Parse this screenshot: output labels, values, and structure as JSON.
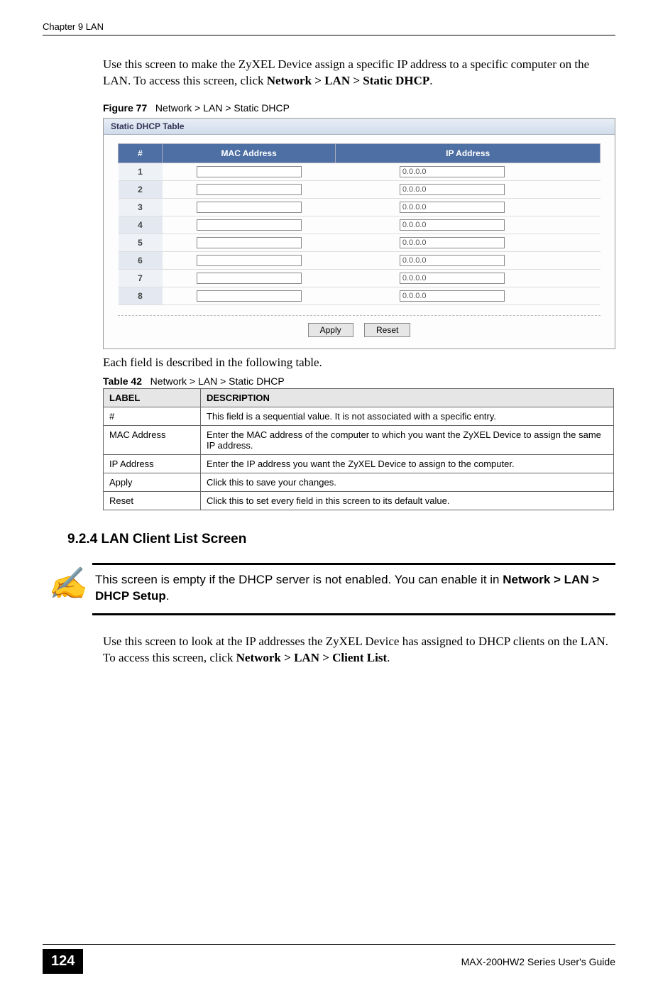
{
  "header": {
    "chapter": "Chapter 9 LAN"
  },
  "intro_para": {
    "pre": "Use this screen to make the ZyXEL Device assign a specific IP address to a specific computer on the LAN. To access this screen, click ",
    "bold": "Network > LAN > Static DHCP",
    "post": "."
  },
  "figure_caption": {
    "label": "Figure 77",
    "text": "Network > LAN > Static DHCP"
  },
  "screenshot": {
    "panel_title": "Static DHCP Table",
    "columns": {
      "num": "#",
      "mac": "MAC Address",
      "ip": "IP Address"
    },
    "rows": [
      {
        "num": "1",
        "mac": "",
        "ip": "0.0.0.0"
      },
      {
        "num": "2",
        "mac": "",
        "ip": "0.0.0.0"
      },
      {
        "num": "3",
        "mac": "",
        "ip": "0.0.0.0"
      },
      {
        "num": "4",
        "mac": "",
        "ip": "0.0.0.0"
      },
      {
        "num": "5",
        "mac": "",
        "ip": "0.0.0.0"
      },
      {
        "num": "6",
        "mac": "",
        "ip": "0.0.0.0"
      },
      {
        "num": "7",
        "mac": "",
        "ip": "0.0.0.0"
      },
      {
        "num": "8",
        "mac": "",
        "ip": "0.0.0.0"
      }
    ],
    "buttons": {
      "apply": "Apply",
      "reset": "Reset"
    }
  },
  "table_intro": "Each field is described in the following table.",
  "table_caption": {
    "label": "Table 42",
    "text": "Network > LAN > Static DHCP"
  },
  "field_table": {
    "headers": {
      "label": "LABEL",
      "desc": "DESCRIPTION"
    },
    "rows": [
      {
        "label": "#",
        "desc": "This field is a sequential value. It is not associated with a specific entry."
      },
      {
        "label": "MAC Address",
        "desc": "Enter the MAC address of the computer to which you want the ZyXEL Device to assign the same IP address."
      },
      {
        "label": "IP Address",
        "desc": "Enter the IP address you want the ZyXEL Device to assign to the computer."
      },
      {
        "label": "Apply",
        "desc": "Click this to save your changes."
      },
      {
        "label": "Reset",
        "desc": "Click this to set every field in this screen to its default value."
      }
    ]
  },
  "section_heading": "9.2.4  LAN Client List Screen",
  "note": {
    "pre": "This screen is empty if the DHCP server is not enabled. You can enable it in ",
    "bold": "Network > LAN > DHCP Setup",
    "post": "."
  },
  "para2": {
    "pre": "Use this screen to look at the IP addresses the ZyXEL Device has assigned to DHCP clients on the LAN. To access this screen, click ",
    "bold": "Network > LAN > Client List",
    "post": "."
  },
  "footer": {
    "page_num": "124",
    "guide": "MAX-200HW2 Series User's Guide"
  },
  "hand_glyph": "✍"
}
